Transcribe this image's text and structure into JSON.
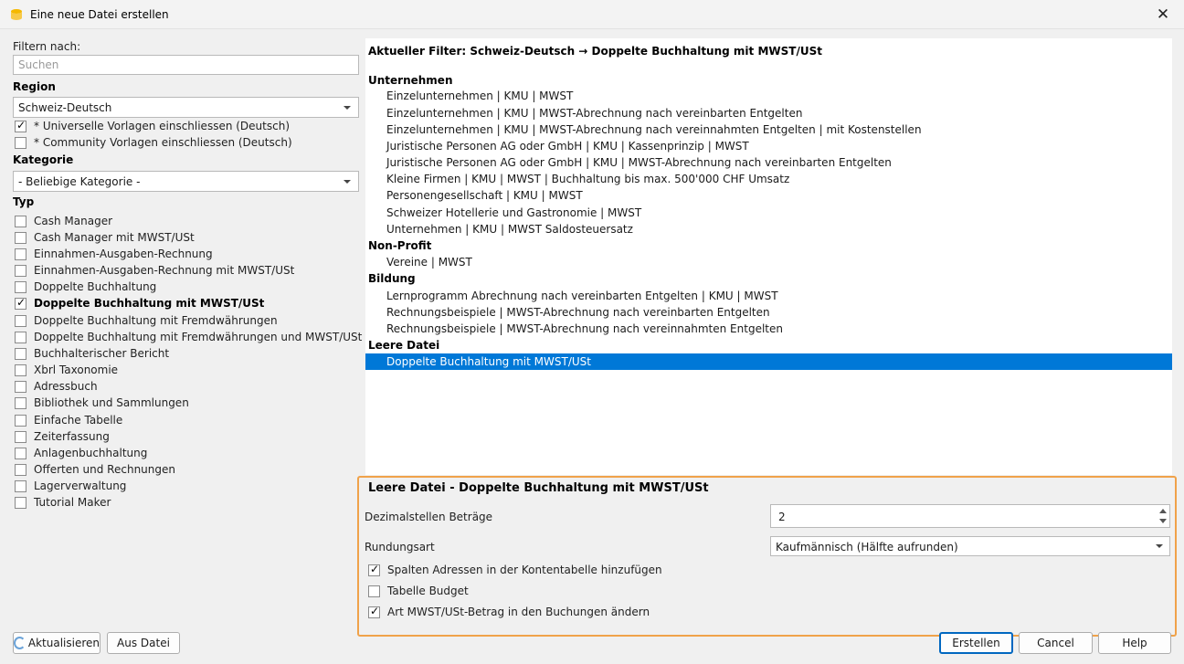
{
  "window": {
    "title": "Eine neue Datei erstellen",
    "close_glyph": "✕"
  },
  "left": {
    "filter_label": "Filtern nach:",
    "search_placeholder": "Suchen",
    "region_label": "Region",
    "region_value": "Schweiz-Deutsch",
    "universal_label": "* Universelle Vorlagen einschliessen (Deutsch)",
    "community_label": "* Community Vorlagen einschliessen (Deutsch)",
    "category_label": "Kategorie",
    "category_value": "- Beliebige Kategorie -",
    "type_label": "Typ",
    "types": [
      "Cash Manager",
      "Cash Manager mit MWST/USt",
      "Einnahmen-Ausgaben-Rechnung",
      "Einnahmen-Ausgaben-Rechnung mit MWST/USt",
      "Doppelte Buchhaltung",
      "Doppelte Buchhaltung mit MWST/USt",
      "Doppelte Buchhaltung mit Fremdwährungen",
      "Doppelte Buchhaltung mit Fremdwährungen und MWST/USt",
      "Buchhalterischer Bericht",
      "Xbrl Taxonomie",
      "Adressbuch",
      "Bibliothek und Sammlungen",
      "Einfache Tabelle",
      "Zeiterfassung",
      "Anlagenbuchhaltung",
      "Offerten und Rechnungen",
      "Lagerverwaltung",
      "Tutorial Maker"
    ],
    "refresh_label": "Aktualisieren",
    "from_file_label": "Aus Datei"
  },
  "list": {
    "current_filter": "Aktueller Filter: Schweiz-Deutsch → Doppelte Buchhaltung mit MWST/USt",
    "group_unternehmen": "Unternehmen",
    "unternehmen": [
      "Einzelunternehmen | KMU | MWST",
      "Einzelunternehmen | KMU | MWST-Abrechnung nach vereinbarten Entgelten",
      "Einzelunternehmen | KMU | MWST-Abrechnung nach vereinnahmten Entgelten | mit Kostenstellen",
      "Juristische Personen AG oder GmbH | KMU | Kassenprinzip | MWST",
      "Juristische Personen AG oder GmbH | KMU | MWST-Abrechnung nach vereinbarten Entgelten",
      "Kleine Firmen | KMU | MWST | Buchhaltung bis max. 500'000 CHF Umsatz",
      "Personengesellschaft | KMU | MWST",
      "Schweizer Hotellerie und Gastronomie | MWST",
      "Unternehmen | KMU | MWST Saldosteuersatz"
    ],
    "group_nonprofit": "Non-Profit",
    "nonprofit": [
      "Vereine | MWST"
    ],
    "group_bildung": "Bildung",
    "bildung": [
      "Lernprogramm Abrechnung nach vereinbarten Entgelten | KMU | MWST",
      "Rechnungsbeispiele | MWST-Abrechnung nach vereinbarten Entgelten",
      "Rechnungsbeispiele | MWST-Abrechnung nach vereinnahmten Entgelten"
    ],
    "group_leer": "Leere Datei",
    "leer": [
      "Doppelte Buchhaltung mit MWST/USt"
    ]
  },
  "options": {
    "title": "Leere Datei - Doppelte Buchhaltung mit MWST/USt",
    "decimals_label": "Dezimalstellen Beträge",
    "decimals_value": "2",
    "rounding_label": "Rundungsart",
    "rounding_value": "Kaufmännisch (Hälfte aufrunden)",
    "addresses_label": "Spalten Adressen in der Kontentabelle hinzufügen",
    "budget_label": "Tabelle Budget",
    "vat_label": "Art MWST/USt-Betrag in den Buchungen ändern"
  },
  "footer": {
    "create_label": "Erstellen",
    "cancel_label": "Cancel",
    "help_label": "Help"
  }
}
